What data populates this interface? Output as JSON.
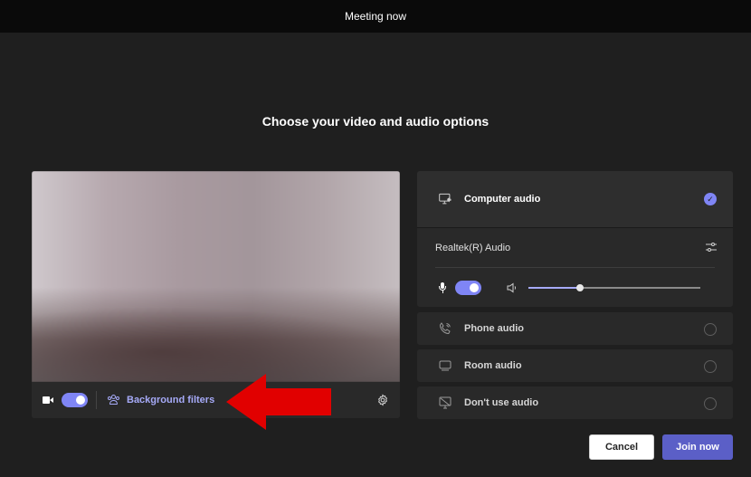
{
  "window": {
    "title": "Meeting now"
  },
  "heading": "Choose your video and audio options",
  "video": {
    "camera_on": true,
    "background_filters_label": "Background filters",
    "icons": {
      "camera": "camera-icon",
      "filters": "people-icon",
      "settings": "gear-icon"
    }
  },
  "audio": {
    "computer_audio": {
      "label": "Computer audio",
      "selected": true,
      "device_name": "Realtek(R) Audio",
      "mic_on": true,
      "volume_percent": 30
    },
    "options": [
      {
        "label": "Phone audio",
        "icon": "phone-icon",
        "selected": false
      },
      {
        "label": "Room audio",
        "icon": "room-icon",
        "selected": false
      },
      {
        "label": "Don't use audio",
        "icon": "no-audio-icon",
        "selected": false
      }
    ]
  },
  "footer": {
    "cancel_label": "Cancel",
    "join_label": "Join now"
  },
  "colors": {
    "accent": "#7f85f5",
    "primary_button": "#5b5fc7",
    "annotation": "#e10000"
  }
}
